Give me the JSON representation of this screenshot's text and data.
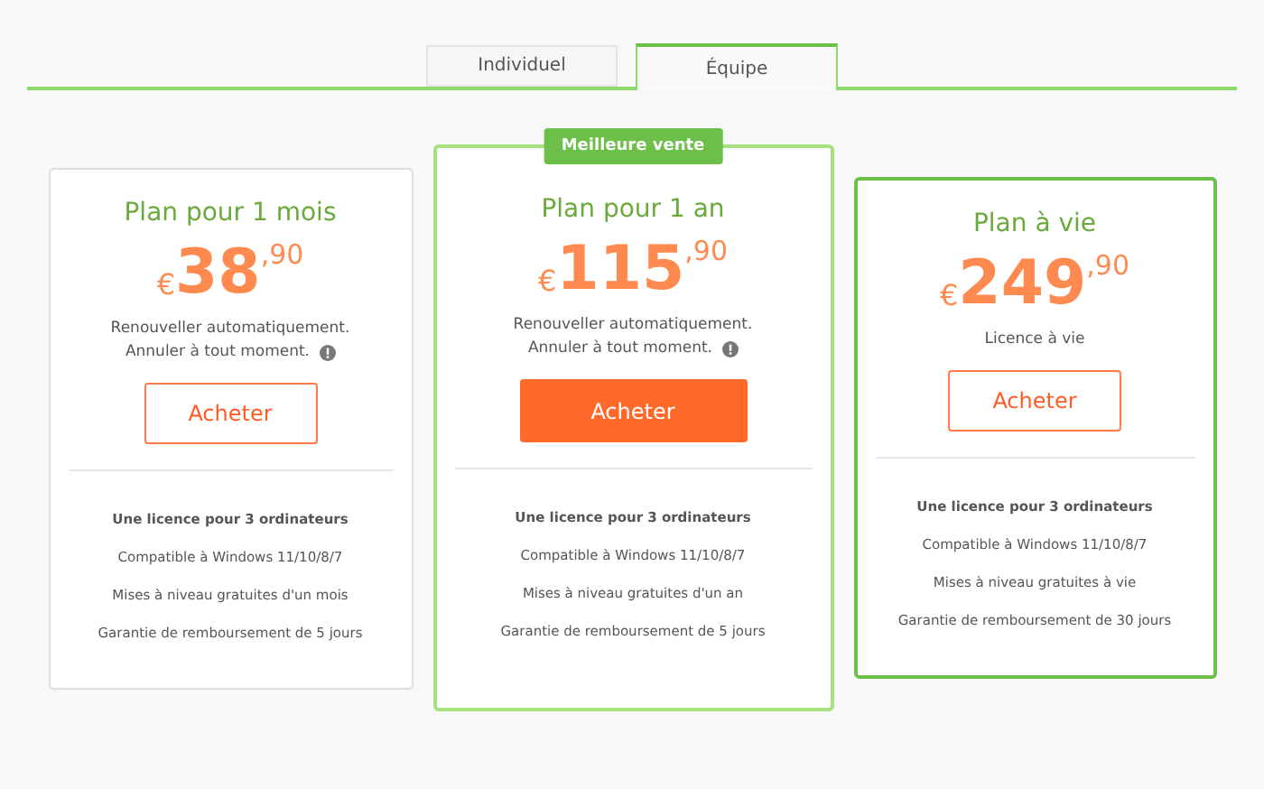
{
  "tabs": [
    {
      "label": "Individuel",
      "selected": false
    },
    {
      "label": "Équipe",
      "selected": true
    }
  ],
  "plans": [
    {
      "kind": "plain",
      "title": "Plan pour 1 mois",
      "price": {
        "currency": "€",
        "whole": "38",
        "cents": ",90"
      },
      "note": [
        "Renouveller automatiquement.",
        "Annuler à tout moment."
      ],
      "info_icon": true,
      "button": {
        "label": "Acheter",
        "primary": false
      },
      "features": [
        {
          "text": "Une licence pour 3 ordinateurs",
          "bold": true
        },
        {
          "text": "Compatible à Windows 11/10/8/7",
          "bold": false
        },
        {
          "text": "Mises à niveau gratuites d'un mois",
          "bold": false
        },
        {
          "text": "Garantie de remboursement de 5 jours",
          "bold": false
        }
      ]
    },
    {
      "kind": "featured",
      "badge": "Meilleure vente",
      "title": "Plan pour 1 an",
      "price": {
        "currency": "€",
        "whole": "115",
        "cents": ",90"
      },
      "note": [
        "Renouveller automatiquement.",
        "Annuler à tout moment."
      ],
      "info_icon": true,
      "button": {
        "label": "Acheter",
        "primary": true
      },
      "features": [
        {
          "text": "Une licence pour 3 ordinateurs",
          "bold": true
        },
        {
          "text": "Compatible à Windows 11/10/8/7",
          "bold": false
        },
        {
          "text": "Mises à niveau gratuites d'un an",
          "bold": false
        },
        {
          "text": "Garantie de remboursement de 5 jours",
          "bold": false
        }
      ]
    },
    {
      "kind": "highlighted",
      "title": "Plan à vie",
      "price": {
        "currency": "€",
        "whole": "249",
        "cents": ",90"
      },
      "note": [
        "Licence à vie"
      ],
      "info_icon": false,
      "button": {
        "label": "Acheter",
        "primary": false
      },
      "features": [
        {
          "text": "Une licence pour 3 ordinateurs",
          "bold": true
        },
        {
          "text": "Compatible à Windows 11/10/8/7",
          "bold": false
        },
        {
          "text": "Mises à niveau gratuites à vie",
          "bold": false
        },
        {
          "text": "Garantie de remboursement de 30 jours",
          "bold": false
        }
      ]
    }
  ]
}
